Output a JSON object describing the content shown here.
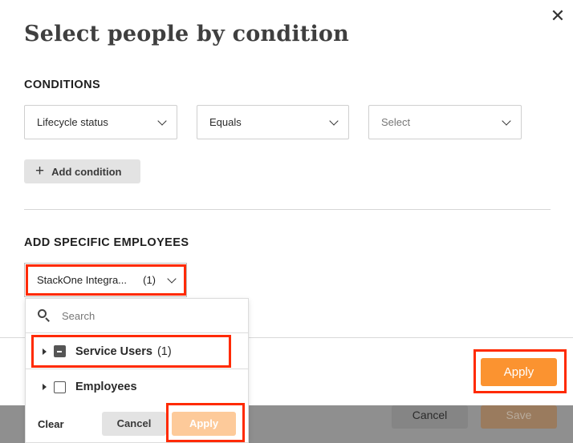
{
  "modal": {
    "title": "Select people by condition",
    "close_icon": "close-icon"
  },
  "conditions": {
    "heading": "CONDITIONS",
    "field_select": {
      "value": "Lifecycle status"
    },
    "operator_select": {
      "value": "Equals"
    },
    "value_select": {
      "placeholder": "Select"
    },
    "add_condition_label": "Add condition"
  },
  "employees": {
    "heading": "ADD SPECIFIC EMPLOYEES",
    "selected_label": "StackOne Integra...",
    "selected_count": "(1)"
  },
  "dropdown": {
    "search_placeholder": "Search",
    "items": [
      {
        "label": "Service Users",
        "count": "(1)",
        "checkbox": "indeterminate"
      },
      {
        "label": "Employees",
        "count": "",
        "checkbox": "unchecked"
      }
    ],
    "clear_label": "Clear",
    "cancel_label": "Cancel",
    "apply_label": "Apply"
  },
  "footer": {
    "apply_label": "Apply",
    "background_cancel_label": "Cancel",
    "background_save_label": "Save"
  },
  "colors": {
    "accent": "#fb9330",
    "accent_disabled": "#fdca9a",
    "highlight_box": "#ff2a00"
  }
}
